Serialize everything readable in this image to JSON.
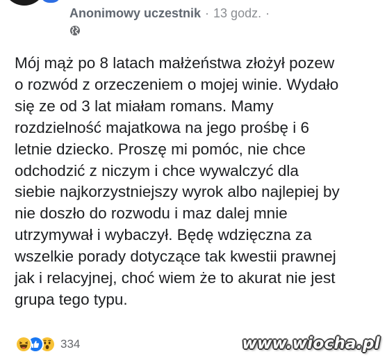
{
  "post": {
    "author": "Anonimowy uczestnik",
    "separator": "·",
    "timestamp": "13 godz.",
    "trailing_separator": "·",
    "privacy_icon": "globe-icon",
    "text_lines": [
      "Mój mąż po 8 latach małżeństwa złożył pozew",
      "o rozwód z orzeczeniem o mojej winie. Wydało",
      "się ze od 3 lat miałam romans. Mamy",
      "rozdzielność majatkowa na jego prośbę i 6",
      "letnie dziecko. Proszę mi pomóc, nie chce",
      "odchodzić z niczym i chce wywalczyć dla",
      "siebie najkorzystniejszy wyrok albo najlepiej by",
      "nie doszło do rozwodu i maz dalej mnie",
      "utrzymywał i wybaczył. Będę wdzięczna za",
      "wszelkie porady dotyczące tak kwestii prawnej",
      "jak i relacyjnej, choć wiem że to akurat nie jest",
      "grupa tego typu."
    ]
  },
  "reactions": {
    "icons": [
      "haha-icon",
      "like-icon",
      "wow-icon"
    ],
    "count": "334"
  },
  "watermark": {
    "text": "www.wiocha.pl"
  },
  "colors": {
    "author": "#606770",
    "meta": "#8a8d91",
    "body_text": "#1c1e21",
    "like_blue": "#1877f2",
    "emoji_yellow": "#f7c135"
  }
}
